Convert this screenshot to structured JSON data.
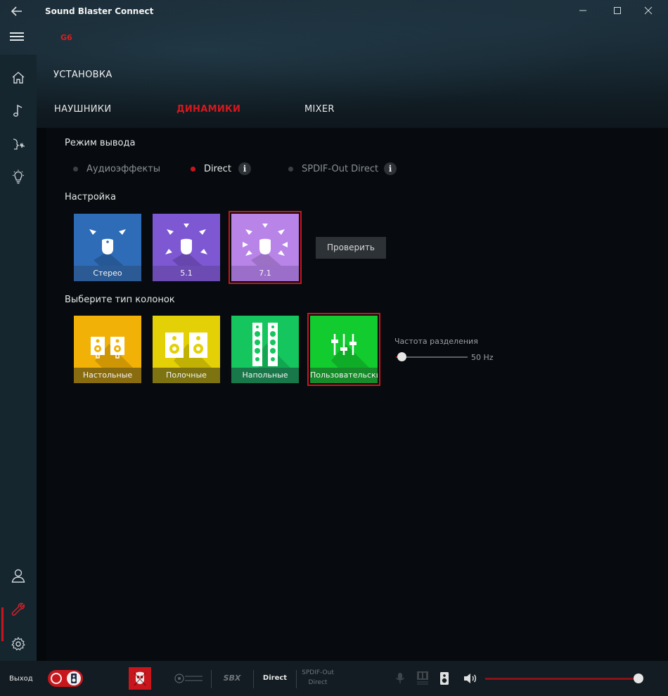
{
  "app": {
    "title": "Sound Blaster Connect",
    "device": "G6"
  },
  "page": {
    "section_title": "УСТАНОВКА",
    "tabs": [
      {
        "label": "НАУШНИКИ",
        "active": false
      },
      {
        "label": "ДИНАМИКИ",
        "active": true
      },
      {
        "label": "MIXER",
        "active": false
      }
    ]
  },
  "output_mode": {
    "label": "Режим вывода",
    "options": [
      {
        "label": "Аудиоэффекты",
        "selected": false,
        "info": false
      },
      {
        "label": "Direct",
        "selected": true,
        "info": true
      },
      {
        "label": "SPDIF-Out Direct",
        "selected": false,
        "info": true
      }
    ],
    "info_glyph": "i"
  },
  "setup": {
    "label": "Настройка",
    "tiles": [
      {
        "label": "Стерео",
        "selected": false,
        "color": "#2f6cb7",
        "icon": "stereo-icon"
      },
      {
        "label": "5.1",
        "selected": false,
        "color": "#7e57d3",
        "icon": "surround-51-icon"
      },
      {
        "label": "7.1",
        "selected": true,
        "color": "#b884e8",
        "icon": "surround-71-icon"
      }
    ],
    "test_button": "Проверить"
  },
  "speaker_type": {
    "label": "Выберите тип колонок",
    "tiles": [
      {
        "label": "Настольные",
        "selected": false,
        "color": "#f2b106",
        "icon": "desktop-speakers-icon"
      },
      {
        "label": "Полочные",
        "selected": false,
        "color": "#e3d007",
        "icon": "bookshelf-speakers-icon"
      },
      {
        "label": "Напольные",
        "selected": false,
        "color": "#15c55e",
        "icon": "floorstanding-speakers-icon"
      },
      {
        "label": "Пользовательские",
        "selected": true,
        "color": "#12cb2e",
        "icon": "custom-sliders-icon"
      }
    ]
  },
  "crossover": {
    "label": "Частота разделения",
    "value": "50 Hz",
    "level": 0.05
  },
  "bottom_bar": {
    "exit_label": "Выход",
    "sbx_label": "SBX",
    "direct_label": "Direct",
    "spdif_line1": "SPDIF-Out",
    "spdif_line2": "Direct",
    "volume_level": 0.99
  },
  "colors": {
    "accent": "#c8161c",
    "sidebar": "#16262f",
    "content_bg": "#070b0f"
  }
}
